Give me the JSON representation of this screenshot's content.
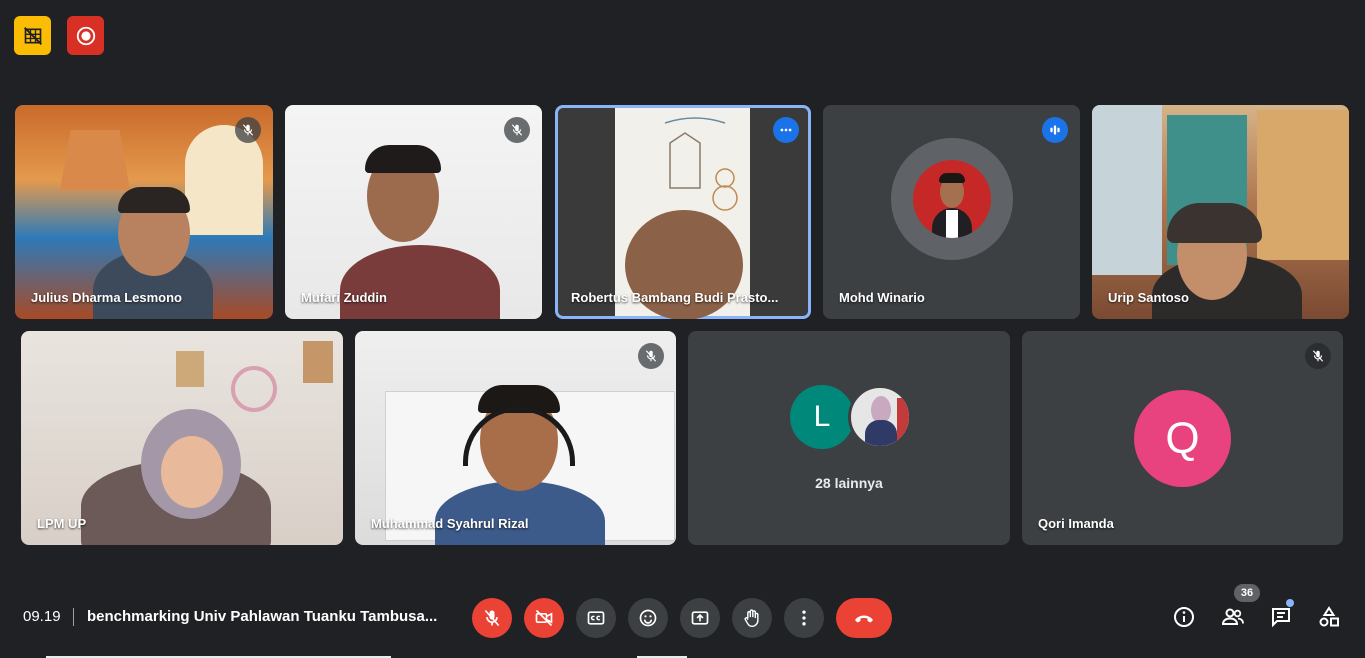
{
  "top_indicators": [
    {
      "icon": "no-video-badge-icon",
      "color": "#fbbc04"
    },
    {
      "icon": "recording-icon",
      "color": "#d93025"
    }
  ],
  "participants": [
    {
      "name": "Julius Dharma Lesmono",
      "mic_muted": true
    },
    {
      "name": "Mufari Zuddin",
      "mic_muted": true
    },
    {
      "name": "Robertus Bambang Budi Prasto...",
      "pinned": true
    },
    {
      "name": "Mohd Winario",
      "speaking": true
    },
    {
      "name": "Urip Santoso"
    },
    {
      "name": "LPM UP"
    },
    {
      "name": "Muhammad Syahrul Rizal",
      "mic_muted": true
    },
    {
      "name": "Qori Imanda",
      "mic_muted": true,
      "avatar_letter": "Q",
      "avatar_color": "#e8437f"
    }
  ],
  "overflow_tile": {
    "avatar_letter": "L",
    "avatar_color": "#00897b",
    "label": "28 lainnya"
  },
  "bottom_bar": {
    "time": "09.19",
    "meeting_title": "benchmarking Univ Pahlawan Tuanku Tambusa...",
    "participant_count": "36",
    "accent_red": "#ea4335"
  }
}
